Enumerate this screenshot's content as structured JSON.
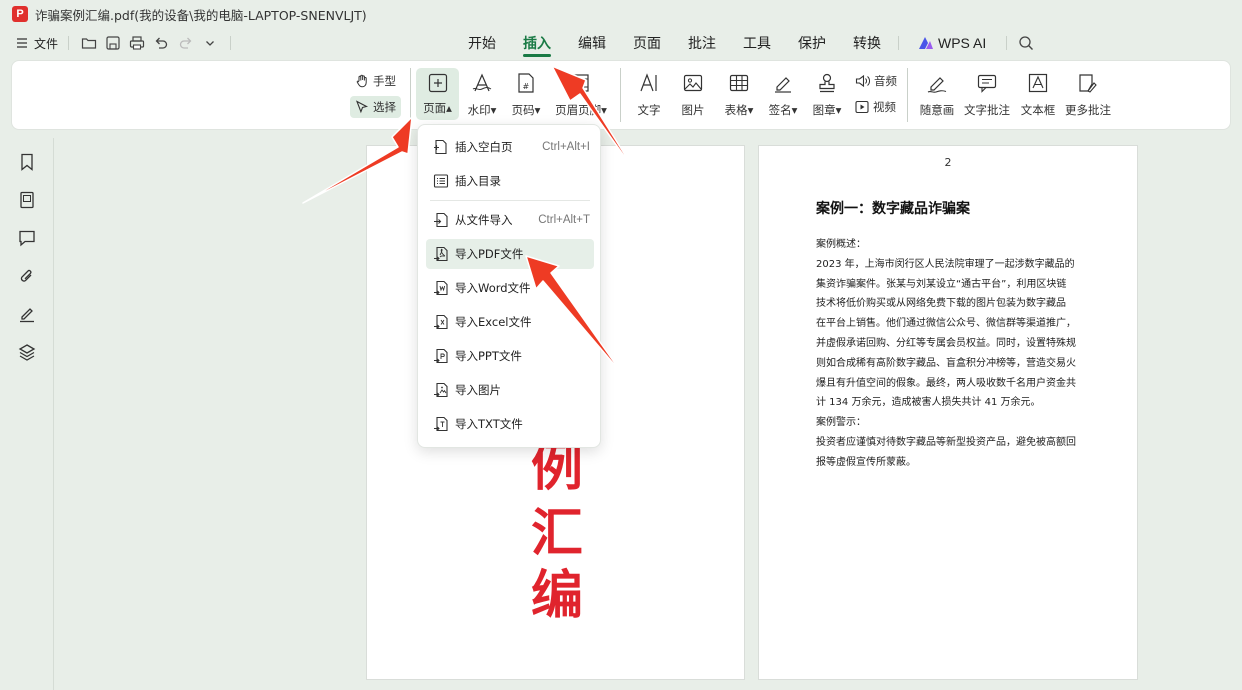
{
  "window": {
    "title": "诈骗案例汇编.pdf(我的设备\\我的电脑-LAPTOP-SNENVLJT)",
    "logo": "P"
  },
  "menubar": {
    "file_label": "文件",
    "tabs": [
      "开始",
      "插入",
      "编辑",
      "页面",
      "批注",
      "工具",
      "保护",
      "转换"
    ],
    "active_tab": "插入",
    "wps_ai_label": "WPS AI"
  },
  "ribbon": {
    "hand_label": "手型",
    "select_label": "选择",
    "page_label": "页面",
    "watermark_label": "水印",
    "page_number_label": "页码",
    "header_footer_label": "页眉页脚",
    "text_label": "文字",
    "image_label": "图片",
    "table_label": "表格",
    "signature_label": "签名",
    "stamp_label": "图章",
    "audio_label": "音频",
    "video_label": "视频",
    "freehand_label": "随意画",
    "text_comment_label": "文字批注",
    "textbox_label": "文本框",
    "more_comments_label": "更多批注"
  },
  "dropdown": {
    "items": [
      {
        "label": "插入空白页",
        "shortcut": "Ctrl+Alt+I",
        "icon": "blank-page-icon"
      },
      {
        "label": "插入目录",
        "shortcut": "",
        "icon": "toc-icon"
      },
      {
        "label": "从文件导入",
        "shortcut": "Ctrl+Alt+T",
        "icon": "import-file-icon"
      },
      {
        "label": "导入PDF文件",
        "shortcut": "",
        "icon": "pdf-file-icon"
      },
      {
        "label": "导入Word文件",
        "shortcut": "",
        "icon": "word-file-icon"
      },
      {
        "label": "导入Excel文件",
        "shortcut": "",
        "icon": "excel-file-icon"
      },
      {
        "label": "导入PPT文件",
        "shortcut": "",
        "icon": "ppt-file-icon"
      },
      {
        "label": "导入图片",
        "shortcut": "",
        "icon": "image-file-icon"
      },
      {
        "label": "导入TXT文件",
        "shortcut": "",
        "icon": "txt-file-icon"
      }
    ],
    "highlighted": "导入PDF文件"
  },
  "page1": {
    "title_chars": [
      "例",
      "汇",
      "编"
    ]
  },
  "page2": {
    "page_number": "2",
    "heading": "案例一：数字藏品诈骗案",
    "lines": [
      "案例概述：",
      "2023 年，上海市闵行区人民法院审理了一起涉数字藏品的",
      "集资诈骗案件。张某与刘某设立“通古平台”，利用区块链",
      "技术将低价购买或从网络免费下载的图片包装为数字藏品",
      "在平台上销售。他们通过微信公众号、微信群等渠道推广，",
      "并虚假承诺回购、分红等专属会员权益。同时，设置特殊规",
      "则如合成稀有高阶数字藏品、盲盒积分冲榜等，营造交易火",
      "爆且有升值空间的假象。最终，两人吸收数千名用户资金共",
      "计 134 万余元，造成被害人损失共计 41 万余元。",
      "案例警示：",
      "投资者应谨慎对待数字藏品等新型投资产品，避免被高额回",
      "报等虚假宣传所蒙蔽。"
    ]
  },
  "colors": {
    "accent": "#1a7a45",
    "annotation_arrow": "#ee3b24",
    "cover_title": "#e0242d"
  }
}
